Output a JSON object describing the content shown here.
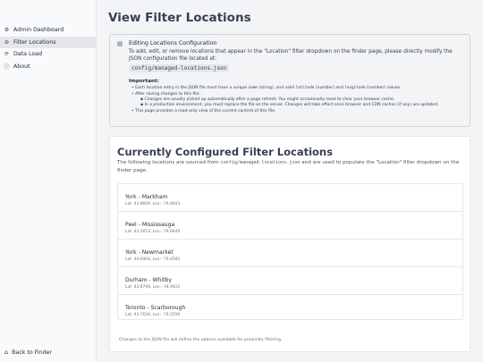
{
  "sidebar": {
    "items": [
      {
        "label": "Admin Dashboard",
        "icon": "gear-icon",
        "active": false
      },
      {
        "label": "Filter Locations",
        "icon": "pin-icon",
        "active": true
      },
      {
        "label": "Data Load",
        "icon": "refresh-icon",
        "active": false
      },
      {
        "label": "About",
        "icon": "info-icon",
        "active": false
      }
    ],
    "back_label": "Back to Finder"
  },
  "page": {
    "title": "View Filter Locations"
  },
  "notice": {
    "title": "Editing Locations Configuration",
    "text": "To add, edit, or remove locations that appear in the \"Location\" filter dropdown on the finder page, please directly modify the JSON configuration file located at:",
    "file": "config/managed-locations.json",
    "important_title": "Important:",
    "b1_pre": "Each location entry in the JSON file must have a unique ",
    "b1_name": "name",
    "b1_mid": " (string), and valid ",
    "b1_lat": "latitude",
    "b1_mid2": " (number) and ",
    "b1_lon": "longitude",
    "b1_post": " (number) values.",
    "b2": "After saving changes to this file:",
    "b2a": "Changes are usually picked up automatically after a page refresh. You might occasionally need to clear your browser cache.",
    "b2b": "In a production environment, you must replace the file on the server. Changes will take effect once browser and CDN caches (if any) are updated.",
    "b3": "This page provides a read-only view of the current content of this file."
  },
  "card": {
    "title": "Currently Configured Filter Locations",
    "desc_pre": "The following locations are sourced from ",
    "desc_file": "config/managed-locations.json",
    "desc_post": " and are used to populate the \"Location\" filter dropdown on the finder page.",
    "locations": [
      {
        "name": "York - Markham",
        "coords": "Lat: 43.8609, Lon: -79.4643"
      },
      {
        "name": "Peel - Mississauga",
        "coords": "Lat: 43.5653, Lon: -79.6449"
      },
      {
        "name": "York - Newmarket",
        "coords": "Lat: 44.0404, Lon: -79.4585"
      },
      {
        "name": "Durham - Whitby",
        "coords": "Lat: 43.8798, Lon: -78.9422"
      },
      {
        "name": "Toronto - Scarborough",
        "coords": "Lat: 43.7634, Lon: -79.2559"
      }
    ],
    "footer": "Changes to the JSON file will define the options available for proximity filtering."
  }
}
